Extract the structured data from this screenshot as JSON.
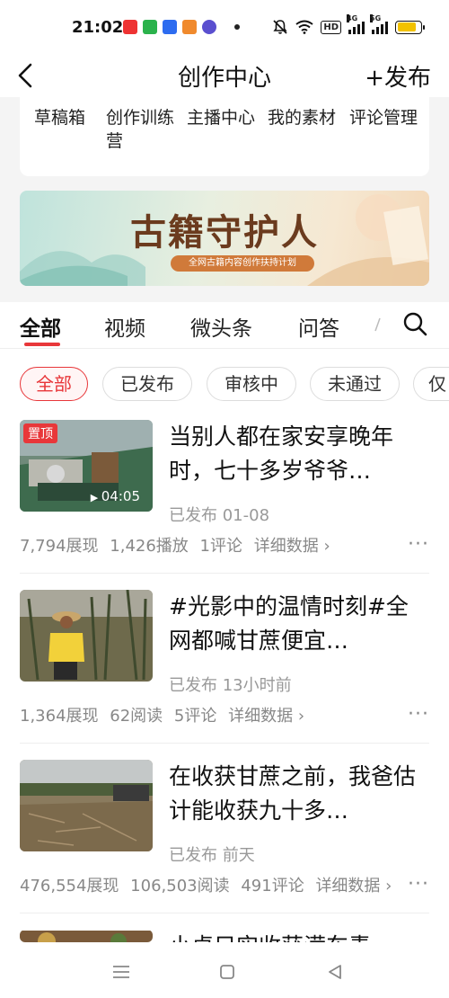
{
  "status_bar": {
    "time": "21:02",
    "left_app_icons": [
      "news-app-icon",
      "wechat-icon",
      "baidu-icon",
      "game-icon",
      "browser-icon"
    ],
    "mute_icon": "bell-off-icon",
    "wifi_icon": "wifi-icon",
    "hd_label": "HD",
    "signal_labels": [
      "4G",
      "5G"
    ],
    "battery_icon": "battery-icon",
    "battery_color": "#f2c200"
  },
  "header": {
    "title": "创作中心",
    "publish_label": "+发布",
    "back_icon": "chevron-left-icon"
  },
  "tools": [
    {
      "label": "草稿箱"
    },
    {
      "label": "创作训练营"
    },
    {
      "label": "主播中心"
    },
    {
      "label": "我的素材"
    },
    {
      "label": "评论管理"
    }
  ],
  "banner": {
    "title": "古籍守护人",
    "subtitle": "全网古籍内容创作扶持计划"
  },
  "tabs": [
    {
      "label": "全部",
      "active": true
    },
    {
      "label": "视频"
    },
    {
      "label": "微头条"
    },
    {
      "label": "问答"
    }
  ],
  "search_icon": "search-icon",
  "filters": [
    {
      "label": "全部",
      "active": true
    },
    {
      "label": "已发布"
    },
    {
      "label": "审核中"
    },
    {
      "label": "未通过"
    },
    {
      "label": "仅"
    }
  ],
  "items": [
    {
      "badge": "置顶",
      "duration": "04:05",
      "title": "当别人都在家安享晚年时，七十多岁爷爷…",
      "status": "已发布  01-08",
      "stats": [
        "7,794展现",
        "1,426播放",
        "1评论"
      ],
      "detail_label": "详细数据 ›",
      "more_label": "···"
    },
    {
      "title": "#光影中的温情时刻#全网都喊甘蔗便宜…",
      "status": "已发布  13小时前",
      "stats": [
        "1,364展现",
        "62阅读",
        "5评论"
      ],
      "detail_label": "详细数据 ›",
      "more_label": "···"
    },
    {
      "title": "在收获甘蔗之前，我爸估计能收获九十多…",
      "status": "已发布  前天",
      "stats": [
        "476,554展现",
        "106,503阅读",
        "491评论"
      ],
      "detail_label": "详细数据 ›",
      "more_label": "···"
    },
    {
      "title": "小卓只实收获满车青"
    }
  ],
  "colors": {
    "accent": "#e8373a",
    "muted_text": "#999999",
    "background_grey": "#f4f4f4"
  },
  "nav": {
    "menu_icon": "menu-icon",
    "home_icon": "home-square-icon",
    "back_icon": "back-triangle-icon"
  }
}
